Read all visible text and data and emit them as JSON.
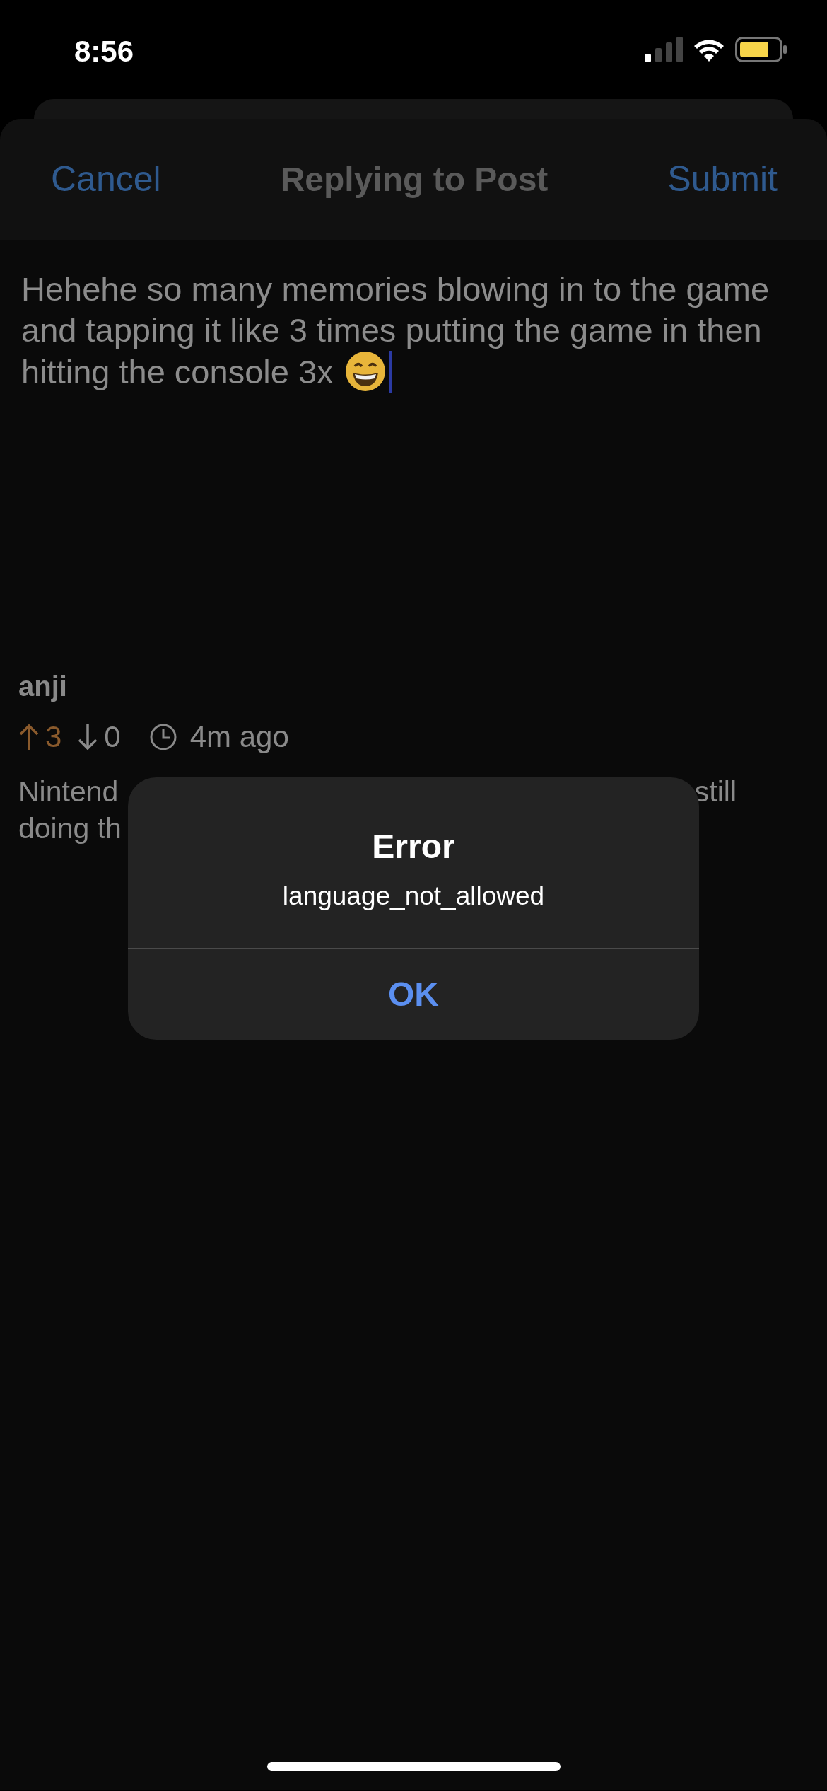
{
  "status_bar": {
    "time": "8:56"
  },
  "header": {
    "cancel": "Cancel",
    "title": "Replying to Post",
    "submit": "Submit"
  },
  "reply": {
    "value": "Hehehe so many memories blowing in to the game and tapping it like 3 times putting the game in then hitting the console 3x",
    "emoji": true
  },
  "comment": {
    "author": "anji",
    "upvotes": "3",
    "upvoted": true,
    "downvotes": "0",
    "downvoted": false,
    "time": "4m ago",
    "body_lines": [
      {
        "left": "Nintend",
        "right": "still"
      },
      {
        "left": "doing th"
      }
    ]
  },
  "alert": {
    "title": "Error",
    "message": "language_not_allowed",
    "buttons": [
      "OK"
    ]
  }
}
